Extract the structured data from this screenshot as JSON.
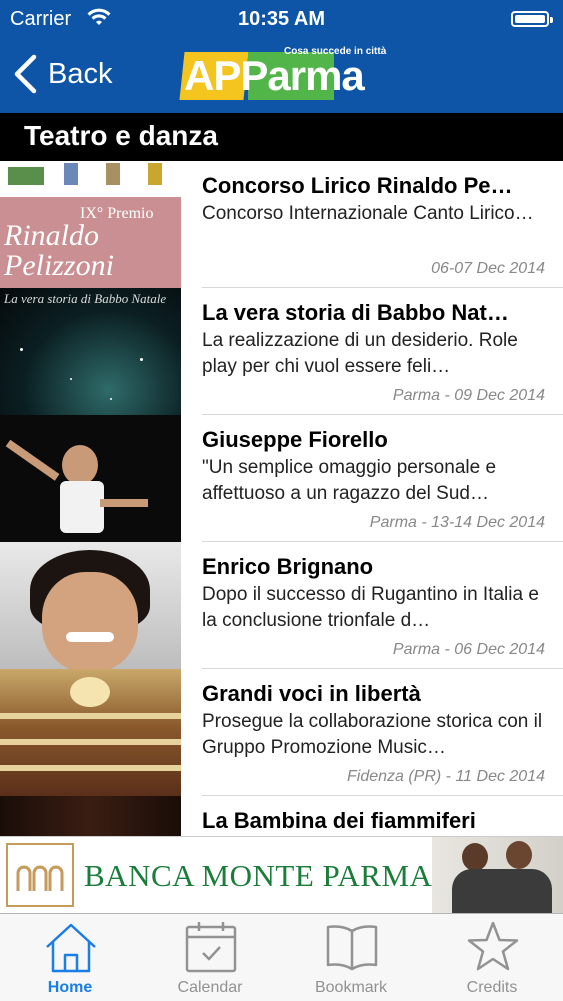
{
  "status_bar": {
    "carrier": "Carrier",
    "time": "10:35 AM"
  },
  "nav": {
    "back_label": "Back",
    "logo_tagline": "Cosa succede in città",
    "logo_ap": "AP",
    "logo_parma": "Parma"
  },
  "section": {
    "title": "Teatro e danza"
  },
  "events": [
    {
      "title": "Concorso Lirico Rinaldo Pe…",
      "desc": "Concorso Internazionale Canto Lirico…",
      "meta": "06-07 Dec 2014",
      "thumb_caption": "Rinaldo Pelizzoni",
      "thumb_premio": "IX° Premio"
    },
    {
      "title": "La vera storia di Babbo Nat…",
      "desc": "La realizzazione di un desiderio. Role play per chi vuol essere feli…",
      "meta": "Parma - 09 Dec 2014",
      "thumb_caption": "La vera storia di Babbo Natale"
    },
    {
      "title": "Giuseppe Fiorello",
      "desc": "\"Un semplice omaggio personale e affettuoso a un ragazzo del Sud…",
      "meta": "Parma - 13-14 Dec 2014"
    },
    {
      "title": "Enrico Brignano",
      "desc": "Dopo il successo di Rugantino in Italia e la conclusione trionfale d…",
      "meta": "Parma - 06 Dec 2014"
    },
    {
      "title": "Grandi voci in libertà",
      "desc": "Prosegue la collaborazione storica con il Gruppo Promozione Music…",
      "meta": "Fidenza (PR) - 11 Dec 2014"
    },
    {
      "title": "La Bambina dei fiammiferi",
      "desc": "",
      "meta": ""
    }
  ],
  "banner": {
    "text": "BANCA MONTE PARMA"
  },
  "tabs": [
    {
      "label": "Home",
      "icon": "home-icon",
      "active": true
    },
    {
      "label": "Calendar",
      "icon": "calendar-icon"
    },
    {
      "label": "Bookmark",
      "icon": "bookmark-icon"
    },
    {
      "label": "Credits",
      "icon": "star-icon"
    }
  ],
  "colors": {
    "nav_blue": "#0e55a7",
    "tab_active": "#1a7ee6",
    "tab_inactive": "#929292",
    "banner_green": "#1a7d3a"
  }
}
